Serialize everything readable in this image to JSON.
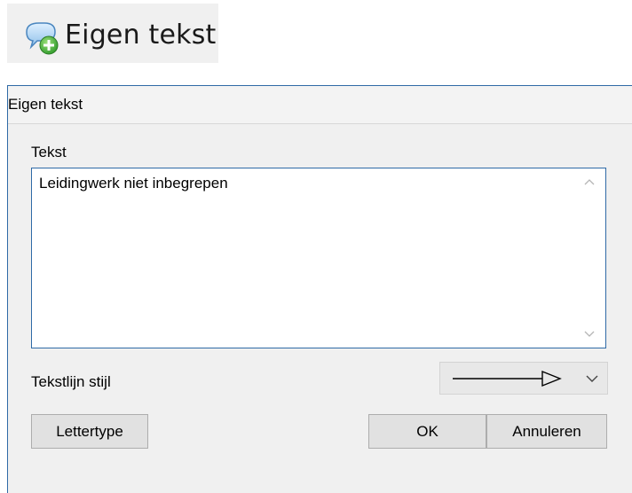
{
  "toolbar": {
    "button_label": "Eigen tekst",
    "icon": "speech-bubble-add-icon"
  },
  "dialog": {
    "title": "Eigen tekst",
    "text_label": "Tekst",
    "text_value": "Leidingwerk niet inbegrepen",
    "line_style_label": "Tekstlijn stijl",
    "line_style_icon": "arrow-line-icon",
    "buttons": {
      "font": "Lettertype",
      "ok": "OK",
      "cancel": "Annuleren"
    }
  },
  "colors": {
    "accent_border": "#2f6aa6",
    "dialog_bg": "#f0f0f0",
    "button_bg": "#e1e1e1"
  }
}
